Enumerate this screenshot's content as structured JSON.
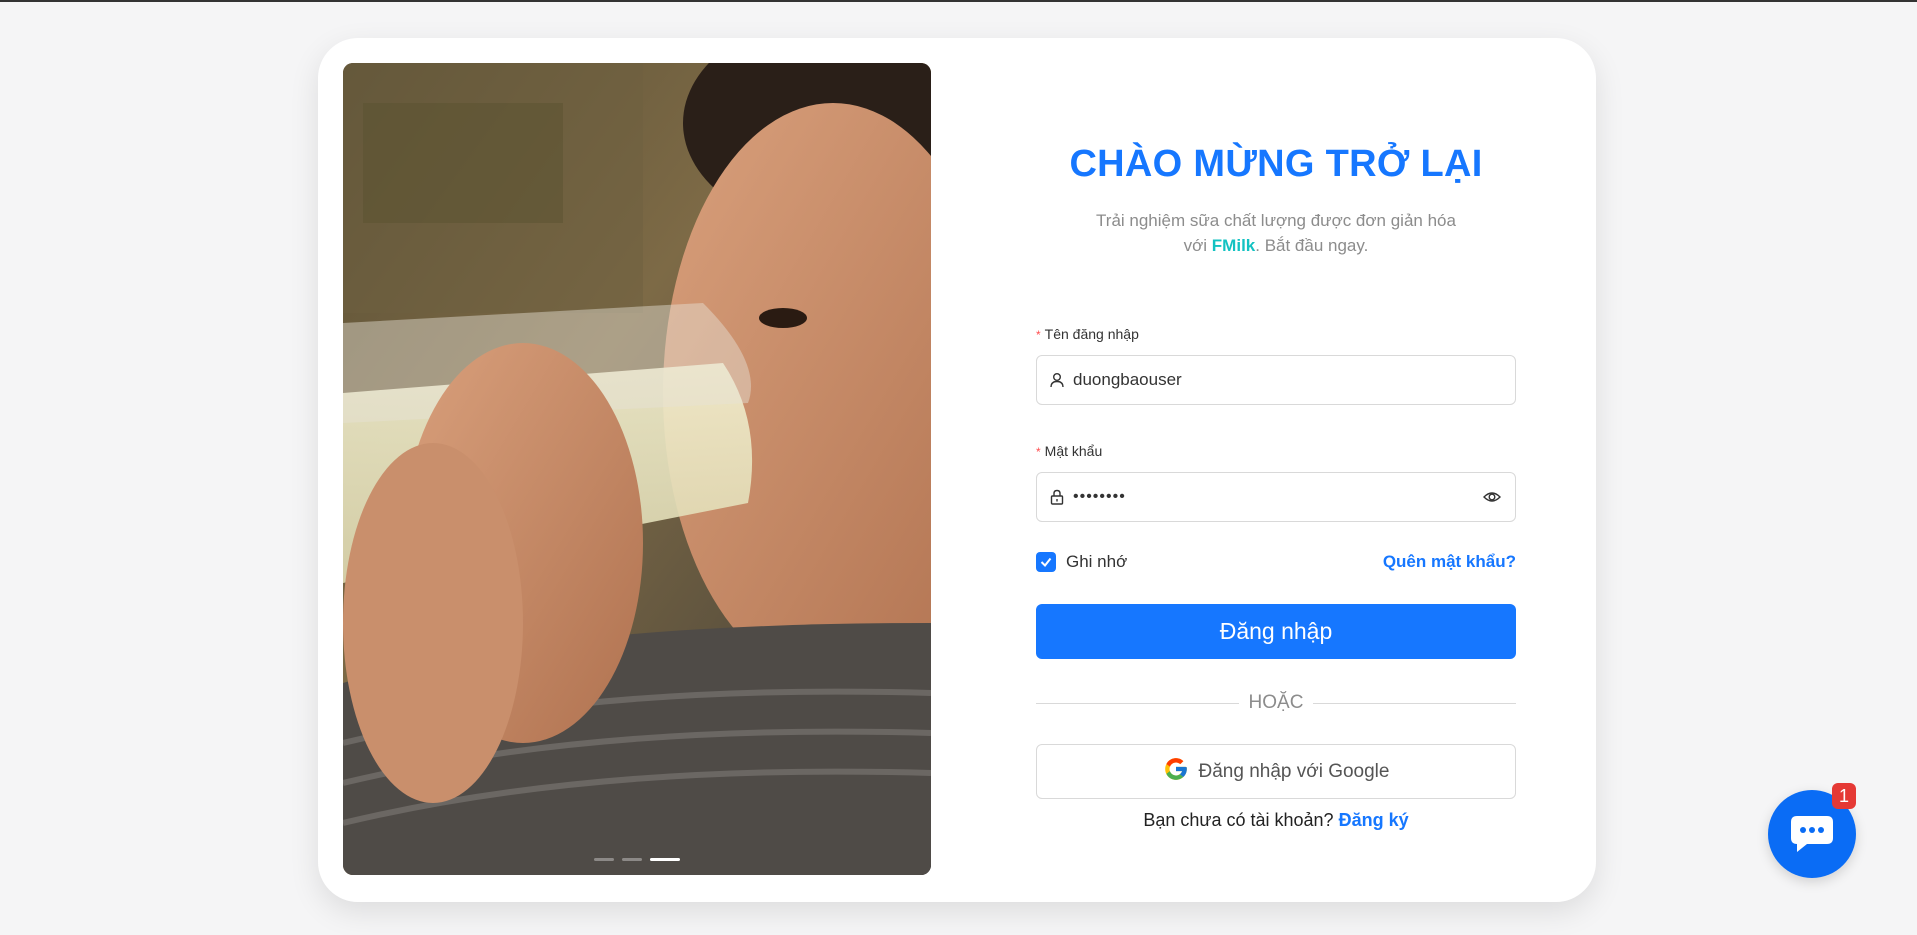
{
  "login": {
    "title": "CHÀO MỪNG TRỞ LẠI",
    "subtitle_before": "Trải nghiệm sữa chất lượng được đơn giản hóa với ",
    "brand": "FMilk",
    "subtitle_after": ". Bắt đầu ngay.",
    "username_label": "Tên đăng nhập",
    "username_value": "duongbaouser",
    "password_label": "Mật khẩu",
    "password_value": "••••••••",
    "remember_label": "Ghi nhớ",
    "remember_checked": true,
    "forgot_label": "Quên mật khẩu?",
    "login_button": "Đăng nhập",
    "divider_text": "HOẶC",
    "google_button": "Đăng nhập với Google",
    "signup_prompt": "Bạn chưa có tài khoản? ",
    "signup_link": "Đăng ký"
  },
  "carousel": {
    "slides": 3,
    "active_index": 2
  },
  "chat": {
    "badge_count": "1"
  },
  "colors": {
    "primary": "#1677ff",
    "brand_accent": "#13c2c2",
    "required": "#ff4d4f",
    "badge": "#e53935"
  },
  "icons": [
    "user-icon",
    "lock-icon",
    "eye-icon",
    "check-icon",
    "google-icon",
    "chat-bubble-icon"
  ]
}
